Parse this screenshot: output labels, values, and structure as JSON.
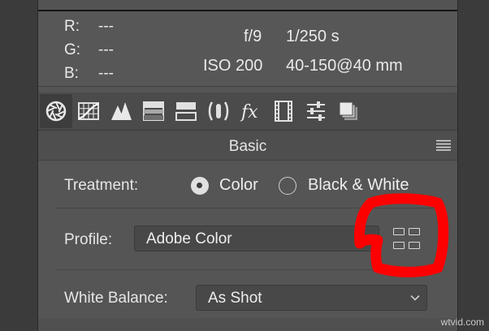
{
  "readout": {
    "r_label": "R:",
    "r_value": "---",
    "g_label": "G:",
    "g_value": "---",
    "b_label": "B:",
    "b_value": "---",
    "aperture": "f/9",
    "shutter": "1/250 s",
    "iso": "ISO 200",
    "lens": "40-150@40 mm"
  },
  "tabs": [
    {
      "icon": "aperture-icon",
      "active": true
    },
    {
      "icon": "tone-curve-icon"
    },
    {
      "icon": "detail-triangles-icon"
    },
    {
      "icon": "hsl-icon"
    },
    {
      "icon": "split-toning-icon"
    },
    {
      "icon": "lens-corrections-icon"
    },
    {
      "icon": "effects-fx-icon"
    },
    {
      "icon": "camera-calibration-icon"
    },
    {
      "icon": "presets-sliders-icon"
    },
    {
      "icon": "snapshots-icon"
    }
  ],
  "section": {
    "title": "Basic"
  },
  "treatment": {
    "label": "Treatment:",
    "options": [
      "Color",
      "Black & White"
    ],
    "selected": "Color"
  },
  "profile": {
    "label": "Profile:",
    "value": "Adobe Color"
  },
  "white_balance": {
    "label": "White Balance:",
    "value": "As Shot"
  },
  "watermark": "wtvid.com",
  "colors": {
    "panel": "#555555",
    "highlight": "#ff0000"
  }
}
